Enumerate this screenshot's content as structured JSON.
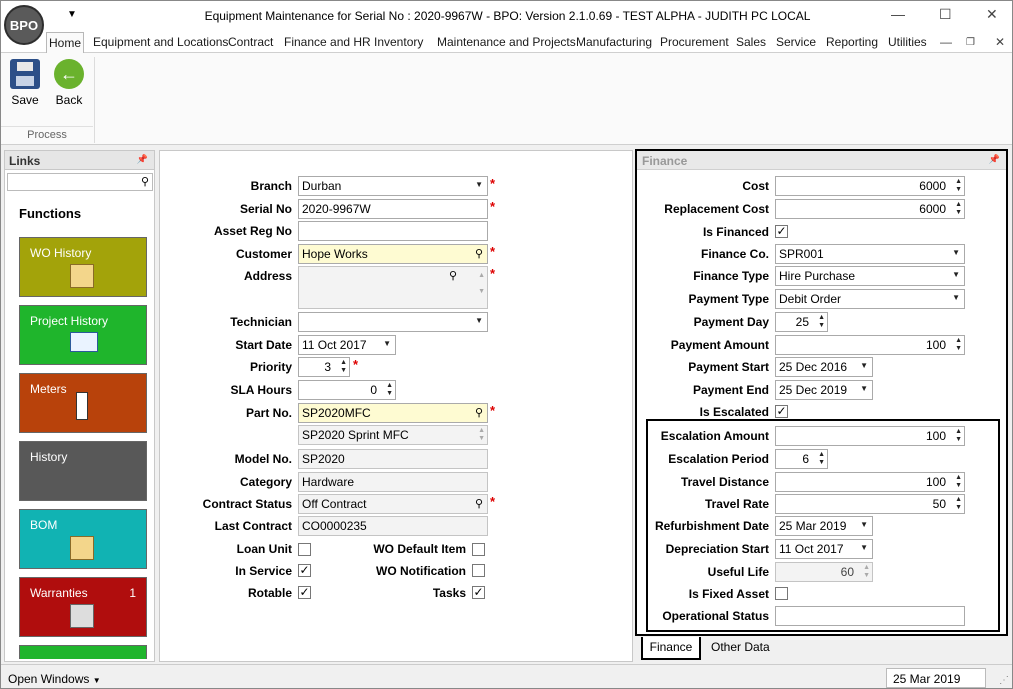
{
  "window": {
    "logo_text": "BPO",
    "title": "Equipment Maintenance for Serial No : 2020-9967W - BPO: Version 2.1.0.69 - TEST ALPHA - JUDITH PC LOCAL",
    "minimize": "—",
    "maximize": "☐",
    "close": "✕"
  },
  "ribbon": {
    "tabs": [
      "Home",
      "Equipment and Locations",
      "Contract",
      "Finance and HR",
      "Inventory",
      "Maintenance and Projects",
      "Manufacturing",
      "Procurement",
      "Sales",
      "Service",
      "Reporting",
      "Utilities"
    ],
    "save_label": "Save",
    "back_label": "Back",
    "group_label": "Process"
  },
  "links": {
    "title": "Links",
    "search_value": "",
    "functions_title": "Functions",
    "tiles": [
      {
        "label": "WO History",
        "color": "#a3a30a"
      },
      {
        "label": "Project History",
        "color": "#1fb52c"
      },
      {
        "label": "Meters",
        "color": "#b8420b"
      },
      {
        "label": "History",
        "color": "#585858"
      },
      {
        "label": "BOM",
        "color": "#11b3b3"
      },
      {
        "label": "Warranties",
        "count": "1",
        "color": "#b00d0d"
      }
    ]
  },
  "form": {
    "branch": {
      "label": "Branch",
      "value": "Durban"
    },
    "serial_no": {
      "label": "Serial No",
      "value": "2020-9967W"
    },
    "asset_reg_no": {
      "label": "Asset Reg No",
      "value": ""
    },
    "customer": {
      "label": "Customer",
      "value": "Hope Works"
    },
    "address": {
      "label": "Address",
      "value": ""
    },
    "technician": {
      "label": "Technician",
      "value": ""
    },
    "start_date": {
      "label": "Start Date",
      "value": "11 Oct 2017"
    },
    "priority": {
      "label": "Priority",
      "value": "3"
    },
    "sla_hours": {
      "label": "SLA Hours",
      "value": "0"
    },
    "part_no": {
      "label": "Part No.",
      "value": "SP2020MFC",
      "description": "SP2020 Sprint MFC"
    },
    "model_no": {
      "label": "Model No.",
      "value": "SP2020"
    },
    "category": {
      "label": "Category",
      "value": "Hardware"
    },
    "contract_status": {
      "label": "Contract Status",
      "value": "Off Contract"
    },
    "last_contract": {
      "label": "Last Contract",
      "value": "CO0000235"
    },
    "loan_unit": {
      "label": "Loan Unit",
      "checked": false
    },
    "in_service": {
      "label": "In Service",
      "checked": true
    },
    "rotable": {
      "label": "Rotable",
      "checked": true
    },
    "wo_default_item": {
      "label": "WO Default Item",
      "checked": false
    },
    "wo_notification": {
      "label": "WO Notification",
      "checked": false
    },
    "tasks": {
      "label": "Tasks",
      "checked": true
    }
  },
  "finance": {
    "title": "Finance",
    "cost": {
      "label": "Cost",
      "value": "6000"
    },
    "replacement_cost": {
      "label": "Replacement Cost",
      "value": "6000"
    },
    "is_financed": {
      "label": "Is Financed",
      "checked": true
    },
    "finance_co": {
      "label": "Finance Co.",
      "value": "SPR001"
    },
    "finance_type": {
      "label": "Finance Type",
      "value": "Hire Purchase"
    },
    "payment_type": {
      "label": "Payment Type",
      "value": "Debit Order"
    },
    "payment_day": {
      "label": "Payment Day",
      "value": "25"
    },
    "payment_amount": {
      "label": "Payment Amount",
      "value": "100"
    },
    "payment_start": {
      "label": "Payment Start",
      "value": "25 Dec 2016"
    },
    "payment_end": {
      "label": "Payment End",
      "value": "25 Dec 2019"
    },
    "is_escalated": {
      "label": "Is Escalated",
      "checked": true
    },
    "escalation_amount": {
      "label": "Escalation Amount",
      "value": "100"
    },
    "escalation_period": {
      "label": "Escalation Period",
      "value": "6"
    },
    "travel_distance": {
      "label": "Travel Distance",
      "value": "100"
    },
    "travel_rate": {
      "label": "Travel Rate",
      "value": "50"
    },
    "refurbishment_date": {
      "label": "Refurbishment Date",
      "value": "25 Mar 2019"
    },
    "depreciation_start": {
      "label": "Depreciation Start",
      "value": "11 Oct 2017"
    },
    "useful_life": {
      "label": "Useful Life",
      "value": "60"
    },
    "is_fixed_asset": {
      "label": "Is Fixed Asset",
      "checked": false
    },
    "operational_status": {
      "label": "Operational Status",
      "value": ""
    }
  },
  "bottom_tabs": [
    "Finance",
    "Other Data"
  ],
  "statusbar": {
    "open_windows": "Open Windows",
    "date": "25 Mar 2019"
  }
}
